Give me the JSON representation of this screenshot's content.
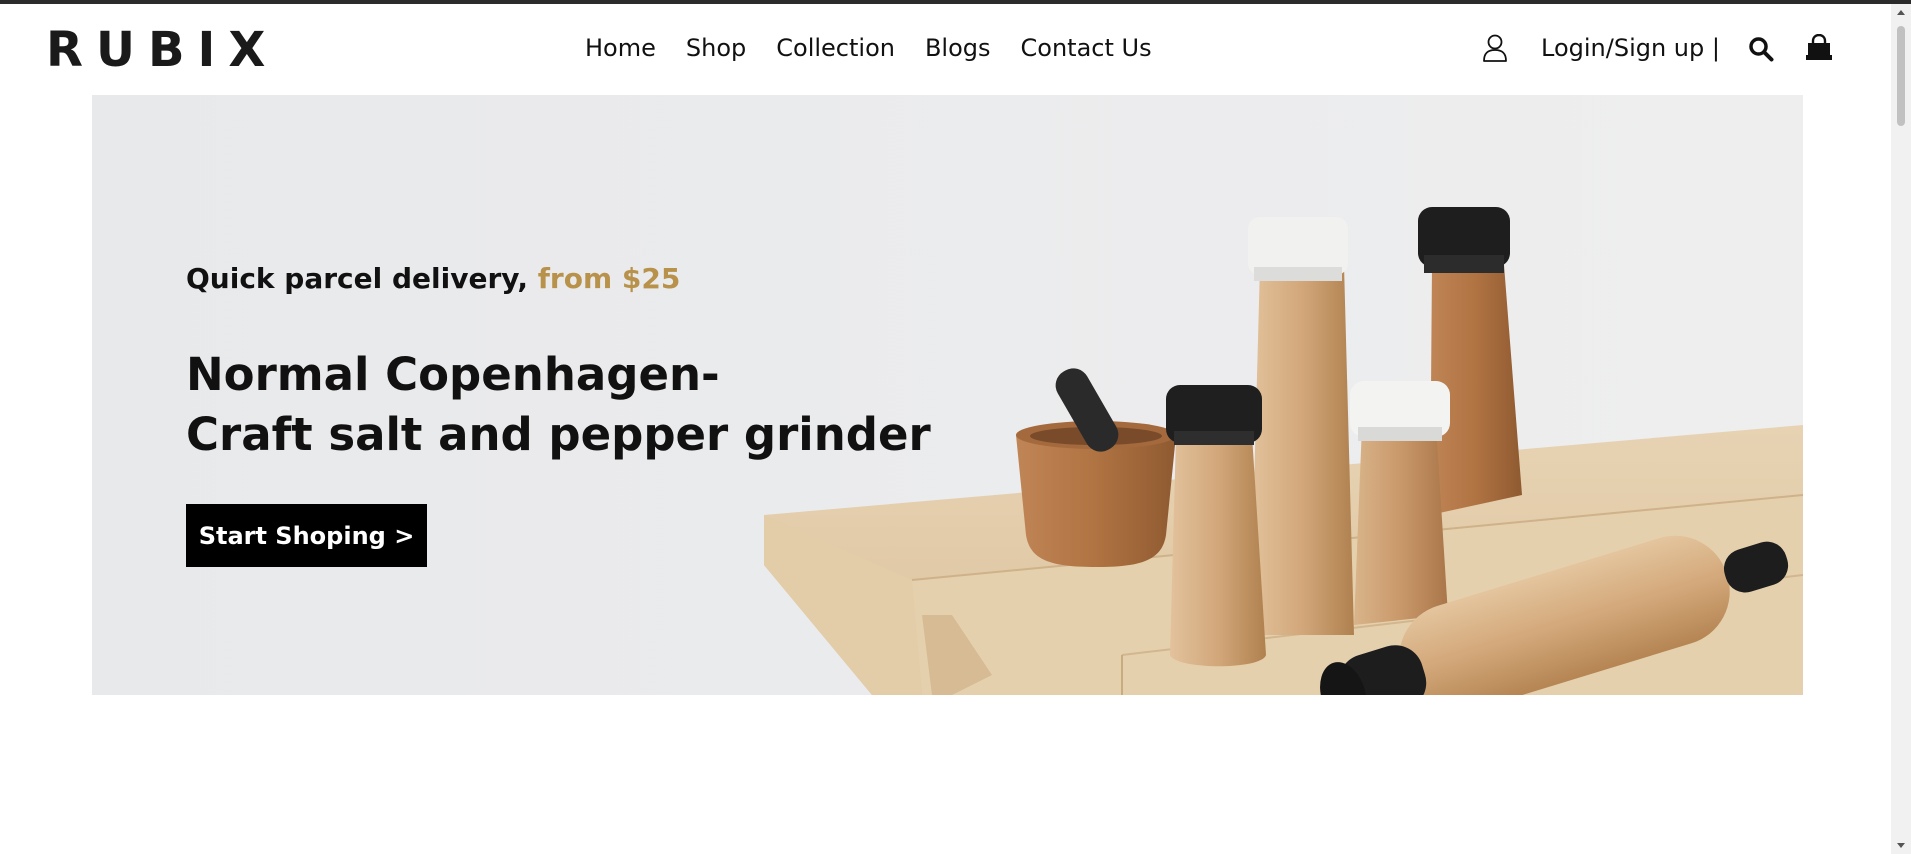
{
  "header": {
    "logo": "RUBIX",
    "nav": [
      "Home",
      "Shop",
      "Collection",
      "Blogs",
      "Contact Us"
    ],
    "login_label": "Login/Sign up |",
    "icons": {
      "user": "user-icon",
      "search": "search-icon",
      "cart": "shopping-bag-icon"
    }
  },
  "hero": {
    "tagline_main": "Quick parcel delivery, ",
    "tagline_accent": "from $25",
    "headline_line1": "Normal Copenhagen-",
    "headline_line2": "Craft salt and pepper grinder",
    "cta_label": "Start Shoping >"
  },
  "colors": {
    "accent": "#b8924a",
    "hero_bg": "#e9eaec",
    "button_bg": "#000000"
  }
}
